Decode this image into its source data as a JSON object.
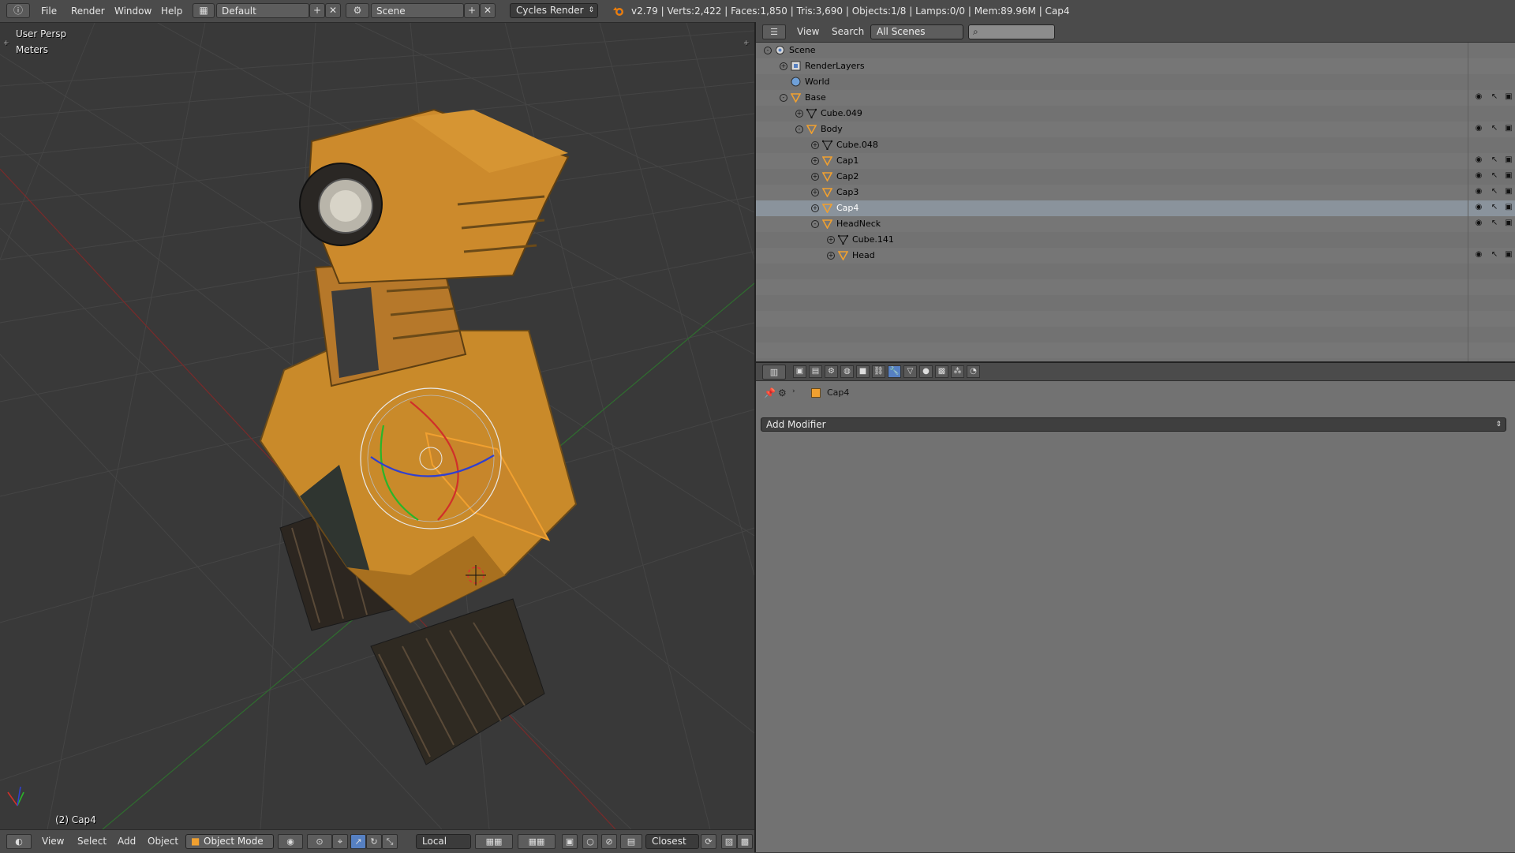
{
  "topbar": {
    "menus": [
      "File",
      "Render",
      "Window",
      "Help"
    ],
    "screen_layout": "Default",
    "scene": "Scene",
    "engine": "Cycles Render",
    "stats": "v2.79 | Verts:2,422 | Faces:1,850 | Tris:3,690 | Objects:1/8 | Lamps:0/0 | Mem:89.96M | Cap4"
  },
  "viewport": {
    "view_name": "User Persp",
    "units": "Meters",
    "active_object": "(2) Cap4"
  },
  "viewport_header": {
    "menus": [
      "View",
      "Select",
      "Add",
      "Object"
    ],
    "mode": "Object Mode",
    "orientation": "Local",
    "snap_target": "Closest"
  },
  "outliner_header": {
    "menus": [
      "View",
      "Search"
    ],
    "display_mode": "All Scenes",
    "search_placeholder": ""
  },
  "outliner": {
    "items": [
      {
        "name": "Scene",
        "depth": 0,
        "icon": "scene-icon",
        "expand": "-",
        "visible_toggles": false
      },
      {
        "name": "RenderLayers",
        "depth": 1,
        "icon": "render-layers-icon",
        "expand": "+",
        "visible_toggles": false
      },
      {
        "name": "World",
        "depth": 1,
        "icon": "world-icon",
        "expand": "",
        "visible_toggles": false
      },
      {
        "name": "Base",
        "depth": 1,
        "icon": "empty-icon",
        "expand": "-",
        "visible_toggles": true
      },
      {
        "name": "Cube.049",
        "depth": 2,
        "icon": "mesh-icon",
        "expand": "+",
        "visible_toggles": false
      },
      {
        "name": "Body",
        "depth": 2,
        "icon": "empty-icon",
        "expand": "-",
        "visible_toggles": true
      },
      {
        "name": "Cube.048",
        "depth": 3,
        "icon": "mesh-icon",
        "expand": "+",
        "visible_toggles": false
      },
      {
        "name": "Cap1",
        "depth": 3,
        "icon": "empty-icon",
        "expand": "+",
        "visible_toggles": true
      },
      {
        "name": "Cap2",
        "depth": 3,
        "icon": "empty-icon",
        "expand": "+",
        "visible_toggles": true
      },
      {
        "name": "Cap3",
        "depth": 3,
        "icon": "empty-icon",
        "expand": "+",
        "visible_toggles": true
      },
      {
        "name": "Cap4",
        "depth": 3,
        "icon": "empty-icon",
        "expand": "+",
        "visible_toggles": true,
        "selected": true
      },
      {
        "name": "HeadNeck",
        "depth": 3,
        "icon": "empty-icon",
        "expand": "-",
        "visible_toggles": true
      },
      {
        "name": "Cube.141",
        "depth": 4,
        "icon": "mesh-icon",
        "expand": "+",
        "visible_toggles": false
      },
      {
        "name": "Head",
        "depth": 4,
        "icon": "empty-icon",
        "expand": "+",
        "visible_toggles": true
      }
    ]
  },
  "properties": {
    "breadcrumb_object": "Cap4",
    "add_modifier_label": "Add Modifier",
    "active_tab": "modifiers"
  },
  "colors": {
    "selection_orange": "#f0a030",
    "active_tab": "#5680c2",
    "axis_x": "#d0302a",
    "axis_y": "#2ab52a",
    "axis_z": "#3040d0"
  }
}
